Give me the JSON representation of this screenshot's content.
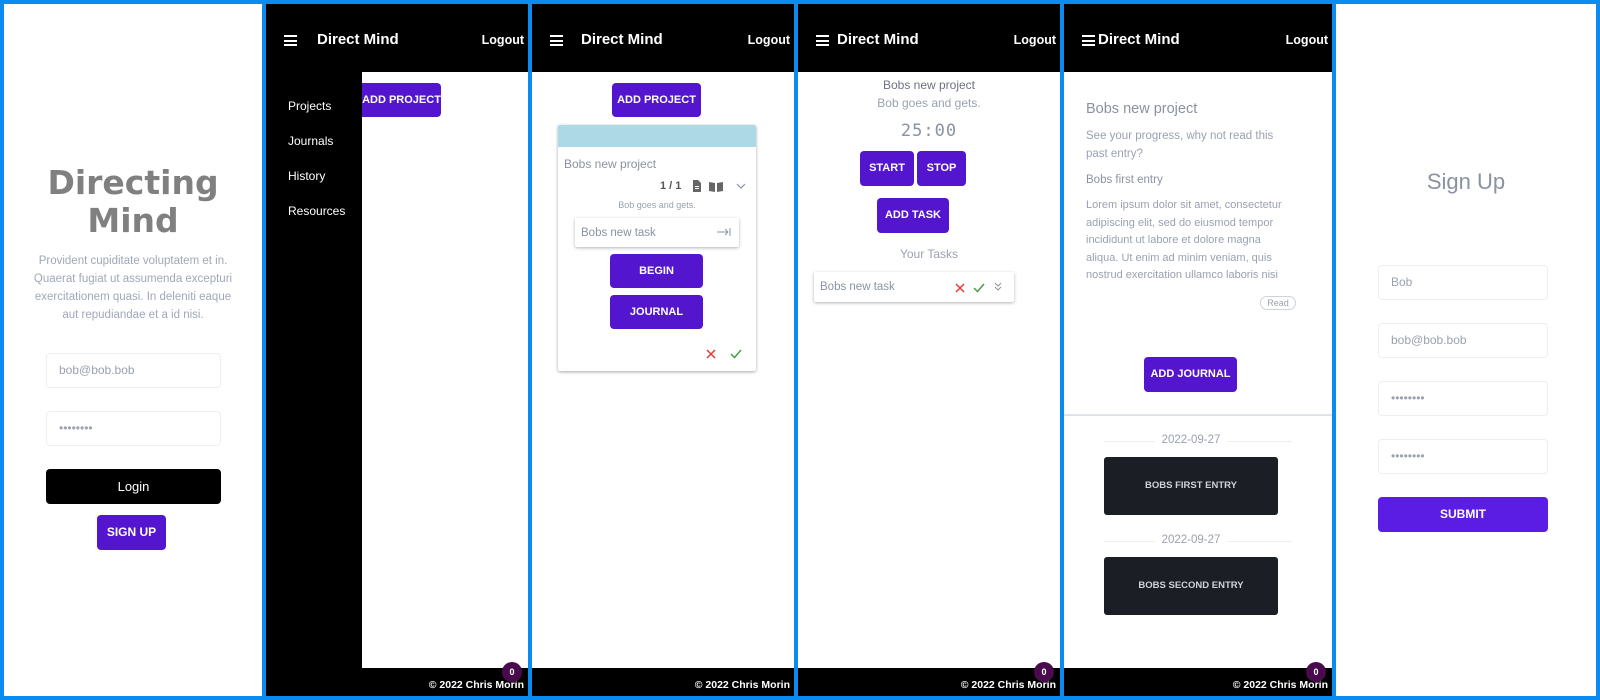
{
  "login": {
    "title_line1": "Directing",
    "title_line2": "Mind",
    "description": "Provident cupiditate voluptatem et in. Quaerat fugiat ut assumenda excepturi exercitationem quasi. In deleniti eaque aut repudiandae et a id nisi.",
    "email_value": "bob@bob.bob",
    "password_value": "••••••••",
    "login_label": "Login",
    "signup_label": "SIGN UP"
  },
  "app": {
    "title": "Direct Mind",
    "logout_label": "Logout",
    "footer_text": "© 2022  Chris Morin",
    "badge_count": "0"
  },
  "drawer": {
    "items": [
      "Projects",
      "Journals",
      "History",
      "Resources"
    ],
    "add_project_label": "ADD PROJECT"
  },
  "projects": {
    "add_project_label": "ADD PROJECT",
    "card": {
      "name": "Bobs new project",
      "progress": "1 / 1",
      "description": "Bob goes and gets.",
      "task_placeholder": "Bobs new task",
      "begin_label": "BEGIN",
      "journal_label": "JOURNAL"
    }
  },
  "timer": {
    "project_name": "Bobs new project",
    "project_description": "Bob goes and gets.",
    "time": "25:00",
    "start_label": "START",
    "stop_label": "STOP",
    "add_task_label": "ADD TASK",
    "tasks_heading": "Your Tasks",
    "task_name": "Bobs new task"
  },
  "journal": {
    "project_name": "Bobs new project",
    "prompt": "See your progress, why not read this past entry?",
    "entry_title": "Bobs first entry",
    "entry_body": "Lorem ipsum dolor sit amet, consectetur adipiscing elit, sed do eiusmod tempor incididunt ut labore et dolore magna aliqua. Ut enim ad minim veniam, quis nostrud exercitation ullamco laboris nisi",
    "read_label": "Read",
    "add_journal_label": "ADD JOURNAL",
    "entries": [
      {
        "date": "2022-09-27",
        "label": "BOBS FIRST ENTRY"
      },
      {
        "date": "2022-09-27",
        "label": "BOBS SECOND ENTRY"
      }
    ]
  },
  "signup": {
    "title": "Sign Up",
    "name_value": "Bob",
    "email_value": "bob@bob.bob",
    "password_value": "••••••••",
    "confirm_value": "••••••••",
    "submit_label": "SUBMIT"
  },
  "colors": {
    "frame": "#0a8bf0",
    "accent": "#5415ce",
    "header": "#000000",
    "card_bar": "#add8e6",
    "entry_button": "#1b1e24",
    "danger": "#e53935",
    "success": "#43a047"
  },
  "icons": [
    "menu-icon",
    "document-icon",
    "book-icon",
    "chevron-down-icon",
    "arrow-enter-icon",
    "close-icon",
    "check-icon",
    "double-chevron-down-icon"
  ]
}
